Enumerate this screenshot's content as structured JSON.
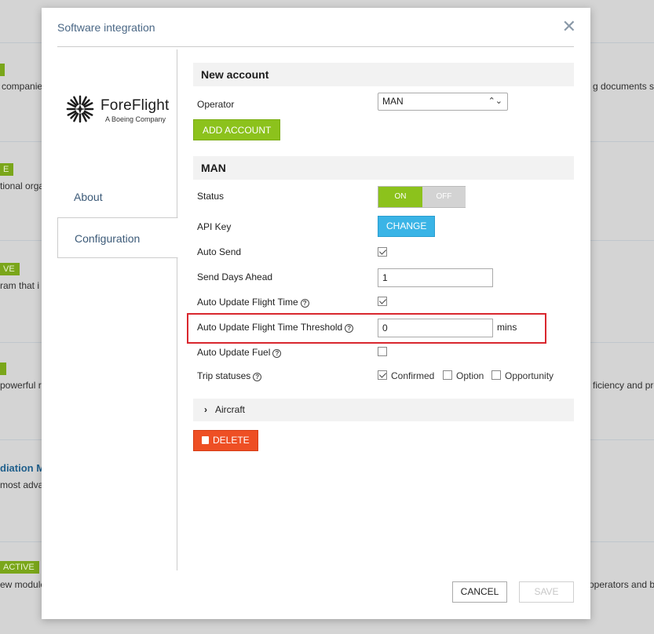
{
  "background": {
    "rows": [
      {
        "badge": "",
        "text_left": "companie",
        "text_right": "g documents se"
      },
      {
        "badge": "E",
        "text_left": "tional orga",
        "text_right": ""
      },
      {
        "badge": "VE",
        "text_left": "ram that i",
        "text_right": ""
      },
      {
        "badge": "",
        "text_left": "powerful r",
        "text_right": "ficiency and pro"
      },
      {
        "badge": "",
        "link": "diation M",
        "text_left": "most adva",
        "text_right": ""
      },
      {
        "badge": "ACTIVE",
        "text_left": "ew module",
        "text_right": "operators and b"
      }
    ]
  },
  "modal": {
    "title": "Software integration",
    "close_glyph": "✕",
    "logo": {
      "name": "ForeFlight",
      "subtitle": "A Boeing Company"
    },
    "nav": {
      "about": "About",
      "configuration": "Configuration"
    },
    "new_account": {
      "heading": "New account",
      "operator_label": "Operator",
      "operator_value": "MAN",
      "add_button": "ADD ACCOUNT"
    },
    "account": {
      "heading": "MAN",
      "status_label": "Status",
      "status_on": "ON",
      "status_off": "OFF",
      "api_key_label": "API Key",
      "change_button": "CHANGE",
      "auto_send_label": "Auto Send",
      "auto_send": true,
      "send_days_label": "Send Days Ahead",
      "send_days_value": "1",
      "auto_update_time_label": "Auto Update Flight Time",
      "auto_update_time": true,
      "threshold_label": "Auto Update Flight Time Threshold",
      "threshold_value": "0",
      "threshold_unit": "mins",
      "auto_update_fuel_label": "Auto Update Fuel",
      "auto_update_fuel": false,
      "trip_statuses_label": "Trip statuses",
      "trip_statuses": [
        {
          "label": "Confirmed",
          "checked": true
        },
        {
          "label": "Option",
          "checked": false
        },
        {
          "label": "Opportunity",
          "checked": false
        }
      ],
      "aircraft_label": "Aircraft",
      "delete_button": "DELETE"
    },
    "footer": {
      "cancel": "CANCEL",
      "save": "SAVE"
    }
  },
  "colors": {
    "accent_green": "#8cc21c",
    "accent_blue": "#3ab4e6",
    "danger": "#ee4f24",
    "highlight": "#d9272e"
  }
}
